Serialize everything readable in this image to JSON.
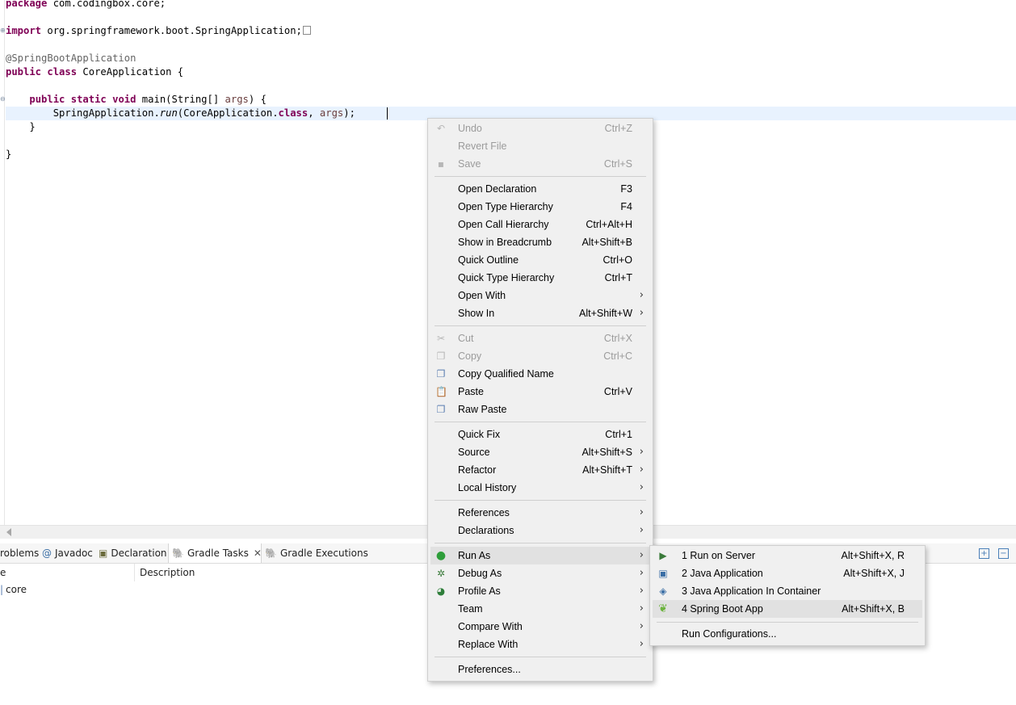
{
  "editor": {
    "lines": {
      "l1": {
        "kw": "package",
        "rest": " com.codingbox.core;"
      },
      "l2": {
        "kw": "import",
        "rest": " org.springframework.boot.SpringApplication;"
      },
      "l3": {
        "ann": "@SpringBootApplication"
      },
      "l4": {
        "kw1": "public",
        "kw2": "class",
        "rest": " CoreApplication {"
      },
      "l5": {
        "indent": "    ",
        "kw1": "public",
        "kw2": "static",
        "kw3": "void",
        "rest1": " main(String[] ",
        "var": "args",
        "rest2": ") {"
      },
      "l6": {
        "indent": "        ",
        "rest1": "SpringApplication.",
        "method": "run",
        "rest2": "(CoreApplication.",
        "kw": "class",
        "rest3": ", ",
        "var": "args",
        "rest4": ");"
      },
      "l7": {
        "text": "    }"
      },
      "l8": {
        "text": "}"
      }
    }
  },
  "bottom_tabs": [
    {
      "label": "roblems"
    },
    {
      "label": "Javadoc",
      "icon": "@"
    },
    {
      "label": "Declaration"
    },
    {
      "label": "Gradle Tasks",
      "close": "✕"
    },
    {
      "label": "Gradle Executions"
    }
  ],
  "gradle_table": {
    "headers": [
      "e",
      "Description"
    ],
    "rows": [
      {
        "name": "core"
      }
    ]
  },
  "context_menu": {
    "items": [
      {
        "label": "Undo",
        "shortcut": "Ctrl+Z",
        "icon": "undo-icon"
      },
      {
        "label": "Revert File"
      },
      {
        "label": "Save",
        "shortcut": "Ctrl+S",
        "icon": "save-icon"
      },
      {
        "label": "Open Declaration",
        "shortcut": "F3"
      },
      {
        "label": "Open Type Hierarchy",
        "shortcut": "F4"
      },
      {
        "label": "Open Call Hierarchy",
        "shortcut": "Ctrl+Alt+H"
      },
      {
        "label": "Show in Breadcrumb",
        "shortcut": "Alt+Shift+B"
      },
      {
        "label": "Quick Outline",
        "shortcut": "Ctrl+O"
      },
      {
        "label": "Quick Type Hierarchy",
        "shortcut": "Ctrl+T"
      },
      {
        "label": "Open With",
        "arrow": "›"
      },
      {
        "label": "Show In",
        "shortcut": "Alt+Shift+W",
        "arrow": "›"
      },
      {
        "label": "Cut",
        "shortcut": "Ctrl+X",
        "icon": "cut-icon"
      },
      {
        "label": "Copy",
        "shortcut": "Ctrl+C",
        "icon": "copy-icon"
      },
      {
        "label": "Copy Qualified Name",
        "icon": "copy-qualified-icon"
      },
      {
        "label": "Paste",
        "shortcut": "Ctrl+V",
        "icon": "paste-icon"
      },
      {
        "label": "Raw Paste",
        "icon": "raw-paste-icon"
      },
      {
        "label": "Quick Fix",
        "shortcut": "Ctrl+1"
      },
      {
        "label": "Source",
        "shortcut": "Alt+Shift+S",
        "arrow": "›"
      },
      {
        "label": "Refactor",
        "shortcut": "Alt+Shift+T",
        "arrow": "›"
      },
      {
        "label": "Local History",
        "arrow": "›"
      },
      {
        "label": "References",
        "arrow": "›"
      },
      {
        "label": "Declarations",
        "arrow": "›"
      },
      {
        "label": "Run As",
        "arrow": "›",
        "icon": "run-icon"
      },
      {
        "label": "Debug As",
        "arrow": "›",
        "icon": "debug-icon"
      },
      {
        "label": "Profile As",
        "arrow": "›",
        "icon": "profile-icon"
      },
      {
        "label": "Team",
        "arrow": "›"
      },
      {
        "label": "Compare With",
        "arrow": "›"
      },
      {
        "label": "Replace With",
        "arrow": "›"
      },
      {
        "label": "Preferences..."
      }
    ]
  },
  "run_as_submenu": {
    "items": [
      {
        "label": "1 Run on Server",
        "shortcut": "Alt+Shift+X, R",
        "icon": "server-icon"
      },
      {
        "label": "2 Java Application",
        "shortcut": "Alt+Shift+X, J",
        "icon": "java-app-icon"
      },
      {
        "label": "3 Java Application In Container",
        "icon": "container-icon"
      },
      {
        "label": "4 Spring Boot App",
        "shortcut": "Alt+Shift+X, B",
        "icon": "spring-boot-icon"
      },
      {
        "label": "Run Configurations..."
      }
    ]
  }
}
